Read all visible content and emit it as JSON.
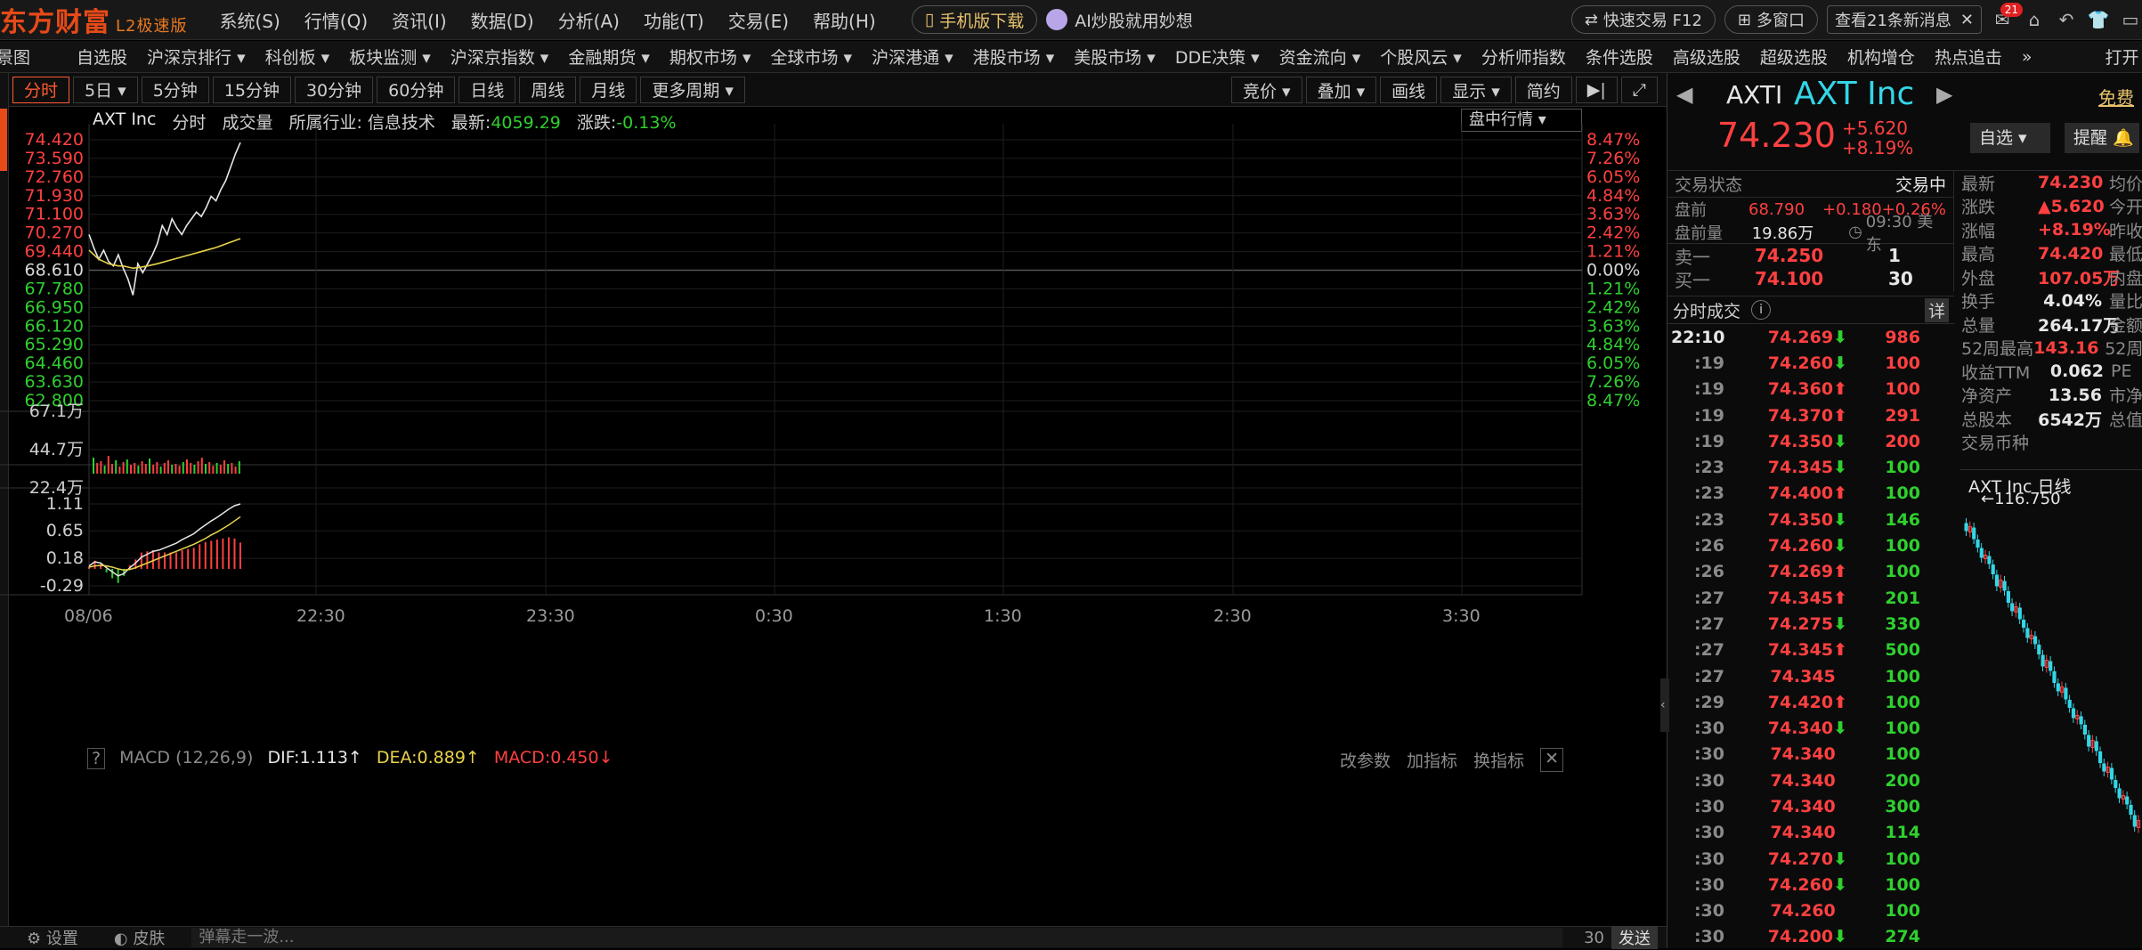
{
  "app": {
    "logo": "东方财富",
    "edition": "L2极速版"
  },
  "menu": [
    "系统(S)",
    "行情(Q)",
    "资讯(I)",
    "数据(D)",
    "分析(A)",
    "功能(T)",
    "交易(E)",
    "帮助(H)"
  ],
  "topbar": {
    "mobile": "手机版下载",
    "ai": "AI炒股就用妙想",
    "quick_trade": "快速交易 F12",
    "multi_window": "多窗口",
    "news": "查看21条新消息",
    "mail_badge": "21"
  },
  "nav": [
    "景图",
    "自选股",
    "沪深京排行 ▾",
    "科创板 ▾",
    "板块监测 ▾",
    "沪深京指数 ▾",
    "金融期货 ▾",
    "期权市场 ▾",
    "全球市场 ▾",
    "沪深港通 ▾",
    "港股市场 ▾",
    "美股市场 ▾",
    "DDE决策 ▾",
    "资金流向 ▾",
    "个股风云 ▾",
    "分析师指数",
    "条件选股",
    "高级选股",
    "超级选股",
    "机构增仓",
    "热点追击",
    "»",
    "打开"
  ],
  "periods": [
    "分时",
    "5日 ▾",
    "5分钟",
    "15分钟",
    "30分钟",
    "60分钟",
    "日线",
    "周线",
    "月线",
    "更多周期 ▾"
  ],
  "chart_tools": [
    "竞价 ▾",
    "叠加 ▾",
    "画线",
    "显示 ▾",
    "简约"
  ],
  "chart_info": {
    "name": "AXT Inc",
    "mode": "分时",
    "vol": "成交量",
    "industry": "所属行业: 信息技术",
    "latest_label": "最新:",
    "latest": "4059.29",
    "chg_label": "涨跌:",
    "chg": "-0.13%",
    "dropdown": "盘中行情 ▾"
  },
  "chart_data": {
    "type": "line",
    "price_ticks": [
      "74.420",
      "73.590",
      "72.760",
      "71.930",
      "71.100",
      "70.270",
      "69.440",
      "68.610",
      "67.780",
      "66.950",
      "66.120",
      "65.290",
      "64.460",
      "63.630",
      "62.800"
    ],
    "pct_ticks": [
      "8.47%",
      "7.26%",
      "6.05%",
      "4.84%",
      "3.63%",
      "2.42%",
      "1.21%",
      "0.00%",
      "1.21%",
      "2.42%",
      "3.63%",
      "4.84%",
      "6.05%",
      "7.26%",
      "8.47%"
    ],
    "vol_ticks": [
      "67.1万",
      "44.7万",
      "22.4万"
    ],
    "macd_ticks": [
      "1.11",
      "0.65",
      "0.18",
      "-0.29"
    ],
    "time_ticks": [
      "08/06",
      "22:30",
      "23:30",
      "0:30",
      "1:30",
      "2:30",
      "3:30"
    ],
    "ylim": [
      62.8,
      74.42
    ],
    "prev_close": 68.61,
    "series": [
      {
        "values": [
          70.2,
          69.6,
          69.1,
          69.5,
          69.0,
          68.8,
          69.3,
          68.7,
          68.2,
          67.5,
          68.9,
          68.5,
          68.9,
          69.3,
          69.8,
          70.6,
          70.2,
          70.9,
          70.5,
          70.2,
          70.6,
          70.9,
          71.2,
          71.0,
          71.4,
          71.9,
          71.7,
          72.2,
          72.6,
          73.2,
          73.8,
          74.3
        ]
      },
      {
        "values": [
          69.5,
          69.3,
          69.1,
          69.0,
          68.9,
          68.85,
          68.8,
          68.8,
          68.75,
          68.7,
          68.72,
          68.76,
          68.8,
          68.85,
          68.9,
          68.96,
          69.02,
          69.08,
          69.14,
          69.2,
          69.26,
          69.32,
          69.38,
          69.44,
          69.5,
          69.56,
          69.62,
          69.7,
          69.78,
          69.86,
          69.94,
          70.02
        ]
      }
    ],
    "volume": [
      1.8,
      1.2,
      1.4,
      0.9,
      2.0,
      1.1,
      1.5,
      0.8,
      1.3,
      1.6,
      1.0,
      1.2,
      0.9,
      1.4,
      1.1,
      1.7,
      1.0,
      1.3,
      0.8,
      1.2,
      1.5,
      1.0,
      1.1,
      0.9,
      1.3,
      1.6,
      1.2,
      1.0,
      1.4,
      1.8,
      1.1,
      1.3,
      0.9,
      1.2,
      1.0,
      1.5,
      1.1,
      1.2,
      0.8,
      1.4
    ],
    "macd": {
      "dif": [
        0.05,
        0.12,
        0.1,
        0.02,
        -0.05,
        -0.12,
        -0.08,
        0.02,
        0.1,
        0.2,
        0.25,
        0.3,
        0.32,
        0.36,
        0.4,
        0.44,
        0.5,
        0.55,
        0.6,
        0.68,
        0.75,
        0.82,
        0.88,
        0.95,
        1.02,
        1.08,
        1.11
      ],
      "dea": [
        0.03,
        0.05,
        0.06,
        0.05,
        0.03,
        0.0,
        -0.02,
        -0.01,
        0.02,
        0.06,
        0.1,
        0.14,
        0.18,
        0.22,
        0.26,
        0.3,
        0.34,
        0.38,
        0.42,
        0.47,
        0.52,
        0.58,
        0.63,
        0.69,
        0.75,
        0.82,
        0.889
      ],
      "hist": [
        0.04,
        0.14,
        0.08,
        -0.06,
        -0.16,
        -0.24,
        -0.12,
        0.06,
        0.16,
        0.28,
        0.3,
        0.32,
        0.28,
        0.28,
        0.28,
        0.28,
        0.32,
        0.34,
        0.36,
        0.42,
        0.46,
        0.48,
        0.5,
        0.52,
        0.54,
        0.52,
        0.45
      ]
    }
  },
  "macd_info": {
    "q": "?",
    "name": "MACD (12,26,9)",
    "dif": "DIF:1.113↑",
    "dea": "DEA:0.889↑",
    "macd": "MACD:0.450↓",
    "t1": "改参数",
    "t2": "加指标",
    "t3": "换指标"
  },
  "status": {
    "settings": "设置",
    "skin": "皮肤",
    "danmu": "弹幕走一波...",
    "count": "30",
    "send": "发送"
  },
  "quote": {
    "code": "AXTI",
    "name": "AXT Inc",
    "price": "74.230",
    "chg": "+5.620",
    "pct": "+8.19%",
    "free": "免费",
    "watch": "自选 ▾",
    "alert": "提醒"
  },
  "trade": {
    "status_label": "交易状态",
    "status": "交易中",
    "pre_label": "盘前",
    "pre_price": "68.790",
    "pre_chg": "+0.180",
    "pre_pct": "+0.26%",
    "pre_vol_label": "盘前量",
    "pre_vol": "19.86万",
    "time": "09:30 美东",
    "sell_label": "卖一",
    "sell_price": "74.250",
    "sell_vol": "1",
    "buy_label": "买一",
    "buy_price": "74.100",
    "buy_vol": "30"
  },
  "ticks_title": "分时成交",
  "ticks_detail": "详",
  "ticks": [
    {
      "t": "22:10",
      "p": "74.269",
      "d": "dn",
      "v": "986",
      "vc": "up"
    },
    {
      "t": ":19",
      "p": "74.260",
      "d": "dn",
      "v": "100",
      "vc": "up"
    },
    {
      "t": ":19",
      "p": "74.360",
      "d": "up",
      "v": "100",
      "vc": "up"
    },
    {
      "t": ":19",
      "p": "74.370",
      "d": "up",
      "v": "291",
      "vc": "up"
    },
    {
      "t": ":19",
      "p": "74.350",
      "d": "dn",
      "v": "200",
      "vc": "up"
    },
    {
      "t": ":23",
      "p": "74.345",
      "d": "dn",
      "v": "100",
      "vc": "dn"
    },
    {
      "t": ":23",
      "p": "74.400",
      "d": "up",
      "v": "100",
      "vc": "dn"
    },
    {
      "t": ":23",
      "p": "74.350",
      "d": "dn",
      "v": "146",
      "vc": "dn"
    },
    {
      "t": ":26",
      "p": "74.260",
      "d": "dn",
      "v": "100",
      "vc": "dn"
    },
    {
      "t": ":26",
      "p": "74.269",
      "d": "up",
      "v": "100",
      "vc": "dn"
    },
    {
      "t": ":27",
      "p": "74.345",
      "d": "up",
      "v": "201",
      "vc": "dn"
    },
    {
      "t": ":27",
      "p": "74.275",
      "d": "dn",
      "v": "330",
      "vc": "dn"
    },
    {
      "t": ":27",
      "p": "74.345",
      "d": "up",
      "v": "500",
      "vc": "dn"
    },
    {
      "t": ":27",
      "p": "74.345",
      "d": "",
      "v": "100",
      "vc": "dn"
    },
    {
      "t": ":29",
      "p": "74.420",
      "d": "up",
      "v": "100",
      "vc": "dn"
    },
    {
      "t": ":30",
      "p": "74.340",
      "d": "dn",
      "v": "100",
      "vc": "dn"
    },
    {
      "t": ":30",
      "p": "74.340",
      "d": "",
      "v": "100",
      "vc": "dn"
    },
    {
      "t": ":30",
      "p": "74.340",
      "d": "",
      "v": "200",
      "vc": "dn"
    },
    {
      "t": ":30",
      "p": "74.340",
      "d": "",
      "v": "300",
      "vc": "dn"
    },
    {
      "t": ":30",
      "p": "74.340",
      "d": "",
      "v": "114",
      "vc": "dn"
    },
    {
      "t": ":30",
      "p": "74.270",
      "d": "dn",
      "v": "100",
      "vc": "dn"
    },
    {
      "t": ":30",
      "p": "74.260",
      "d": "dn",
      "v": "100",
      "vc": "dn"
    },
    {
      "t": ":30",
      "p": "74.260",
      "d": "",
      "v": "100",
      "vc": "dn"
    },
    {
      "t": ":30",
      "p": "74.200",
      "d": "dn",
      "v": "274",
      "vc": "dn"
    }
  ],
  "stats": [
    {
      "l": "最新",
      "v": "74.230",
      "c": "up",
      "r": "均价"
    },
    {
      "l": "涨跌",
      "v": "▲5.620",
      "c": "up",
      "r": "今开"
    },
    {
      "l": "涨幅",
      "v": "+8.19%",
      "c": "up",
      "r": "昨收"
    },
    {
      "l": "最高",
      "v": "74.420",
      "c": "up",
      "r": "最低"
    },
    {
      "l": "外盘",
      "v": "107.05万",
      "c": "up",
      "r": "内盘"
    },
    {
      "l": "换手",
      "v": "4.04%",
      "c": "wh",
      "r": "量比"
    },
    {
      "l": "总量",
      "v": "264.17万",
      "c": "wh",
      "r": "金额"
    },
    {
      "l": "52周最高",
      "v": "143.16",
      "c": "up",
      "r": "52周"
    },
    {
      "l": "收益TTM",
      "v": "0.062",
      "c": "wh",
      "r": "PE"
    },
    {
      "l": "净资产",
      "v": "13.56",
      "c": "wh",
      "r": "市净"
    },
    {
      "l": "总股本",
      "v": "6542万",
      "c": "wh",
      "r": "总值"
    },
    {
      "l": "交易币种",
      "v": "",
      "c": "wh",
      "r": ""
    }
  ],
  "daily": {
    "title": "AXT Inc 日线",
    "high": "←116.750"
  }
}
